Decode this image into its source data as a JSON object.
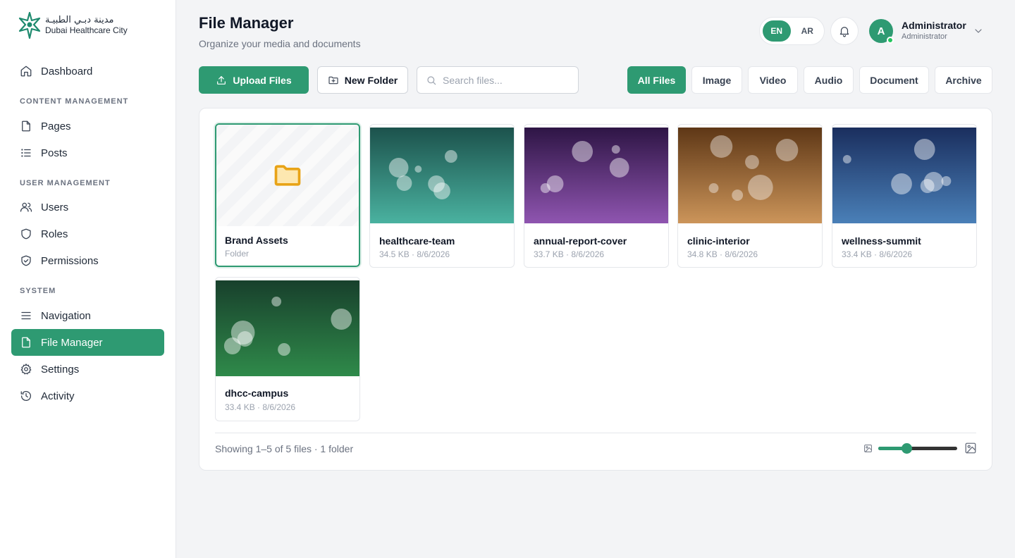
{
  "brand": {
    "name_ar": "مدينة دبـي الطبيـة",
    "name_en": "Dubai Healthcare City",
    "color": "#1e8a6e"
  },
  "sidebar": {
    "dashboard": {
      "label": "Dashboard",
      "icon": "home-icon"
    },
    "sections": {
      "content": "CONTENT MANAGEMENT",
      "users": "USER MANAGEMENT",
      "system": "SYSTEM"
    },
    "items": {
      "pages": "Pages",
      "posts": "Posts",
      "users": "Users",
      "roles": "Roles",
      "permissions": "Permissions",
      "navigation": "Navigation",
      "file_manager": "File Manager",
      "settings": "Settings",
      "activity": "Activity"
    },
    "active": "file_manager"
  },
  "header": {
    "title": "File Manager",
    "subtitle": "Organize your media and documents",
    "lang": {
      "en": "EN",
      "ar": "AR",
      "active": "EN"
    },
    "user": {
      "initial": "A",
      "name": "Administrator",
      "role": "Administrator"
    }
  },
  "toolbar": {
    "upload_label": "Upload Files",
    "new_folder_label": "New Folder",
    "search_placeholder": "Search files...",
    "search_value": "",
    "filters": [
      "All Files",
      "Image",
      "Video",
      "Audio",
      "Document",
      "Archive"
    ],
    "active_filter": "All Files"
  },
  "items": [
    {
      "name": "Brand Assets",
      "meta": "Folder",
      "type": "folder"
    },
    {
      "name": "healthcare-team",
      "meta": "34.5 KB · 8/6/2026",
      "type": "image",
      "colors": [
        "#1c524c",
        "#4ab2a0"
      ]
    },
    {
      "name": "annual-report-cover",
      "meta": "33.7 KB · 8/6/2026",
      "type": "image",
      "colors": [
        "#2e1545",
        "#8f55b0"
      ]
    },
    {
      "name": "clinic-interior",
      "meta": "34.8 KB · 8/6/2026",
      "type": "image",
      "colors": [
        "#5e3716",
        "#cc955a"
      ]
    },
    {
      "name": "wellness-summit",
      "meta": "33.4 KB · 8/6/2026",
      "type": "image",
      "colors": [
        "#1a2e5e",
        "#4a80b8"
      ]
    },
    {
      "name": "dhcc-campus",
      "meta": "33.4 KB · 8/6/2026",
      "type": "image",
      "colors": [
        "#18402c",
        "#2f8a4a"
      ]
    }
  ],
  "footer": {
    "summary": "Showing 1–5 of 5 files · 1 folder",
    "thumb_size_fraction": 0.36
  }
}
